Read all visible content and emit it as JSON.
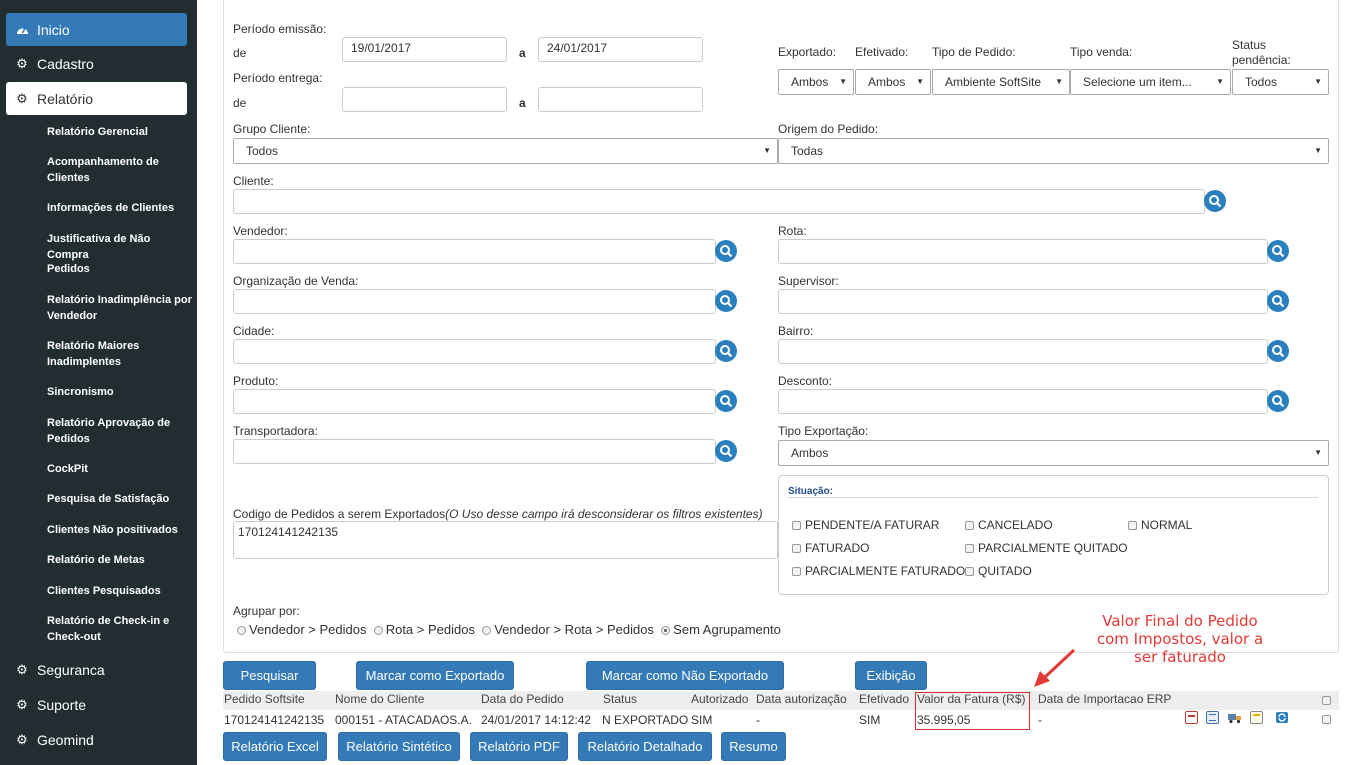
{
  "sidebar": {
    "top": [
      {
        "label": "Inicio",
        "icon": "dashboard-icon"
      },
      {
        "label": "Cadastro",
        "icon": "gears-icon"
      },
      {
        "label": "Relatório",
        "icon": "gears-icon"
      }
    ],
    "subitems": [
      "Relatório Gerencial",
      "Acompanhamento de Clientes",
      "Informações de Clientes",
      "Justificativa de Não Compra",
      "Pedidos",
      "Relatório Inadimplência por Vendedor",
      "Relatório Maiores Inadimplentes",
      "Sincronismo",
      "Relatório Aprovação de Pedidos",
      "CockPit",
      "Pesquisa de Satisfação",
      "Clientes Não positivados",
      "Relatório de Metas",
      "Clientes Pesquisados",
      "Relatório de Check-in e Check-out"
    ],
    "bottom": [
      {
        "label": "Seguranca",
        "icon": "gears-icon"
      },
      {
        "label": "Suporte",
        "icon": "gears-icon"
      },
      {
        "label": "Geomind",
        "icon": "gears-icon"
      }
    ]
  },
  "filters": {
    "periodo_emissao": "Período emissão:",
    "de": "de",
    "a": "a",
    "emissao_de": "19/01/2017",
    "emissao_ate": "24/01/2017",
    "periodo_entrega": "Período entrega:",
    "entrega_de": "",
    "entrega_ate": "",
    "exportado_label": "Exportado:",
    "exportado_value": "Ambos",
    "efetivado_label": "Efetivado:",
    "efetivado_value": "Ambos",
    "tipo_pedido_label": "Tipo de Pedido:",
    "tipo_pedido_value": "Ambiente SoftSite",
    "tipo_venda_label": "Tipo venda:",
    "tipo_venda_value": "Selecione um item...",
    "status_pendencia_label": "Status pendência:",
    "status_pendencia_value": "Todos",
    "grupo_cliente_label": "Grupo Cliente:",
    "grupo_cliente_value": "Todos",
    "origem_pedido_label": "Origem do Pedido:",
    "origem_pedido_value": "Todas",
    "cliente_label": "Cliente:",
    "vendedor_label": "Vendedor:",
    "rota_label": "Rota:",
    "org_venda_label": "Organização de Venda:",
    "supervisor_label": "Supervisor:",
    "cidade_label": "Cidade:",
    "bairro_label": "Bairro:",
    "produto_label": "Produto:",
    "desconto_label": "Desconto:",
    "transportadora_label": "Transportadora:",
    "tipo_exportacao_label": "Tipo Exportação:",
    "tipo_exportacao_value": "Ambos",
    "codigo_label": "Codigo de Pedidos a serem Exportados",
    "codigo_hint": "(O Uso desse campo irá desconsiderar os filtros existentes)",
    "codigo_value": "170124141242135",
    "situacao_title": "Situação:",
    "situacao": [
      "PENDENTE/A FATURAR",
      "CANCELADO",
      "NORMAL",
      "FATURADO",
      "PARCIALMENTE QUITADO",
      "PARCIALMENTE FATURADO",
      "QUITADO"
    ],
    "agrupar_label": "Agrupar por:",
    "agrupar": [
      "Vendedor > Pedidos",
      "Rota > Pedidos",
      "Vendedor > Rota > Pedidos",
      "Sem Agrupamento"
    ],
    "agrupar_selected": "Sem Agrupamento"
  },
  "actions": {
    "pesquisar": "Pesquisar",
    "marcar_exportado": "Marcar como Exportado",
    "marcar_nao_exportado": "Marcar como Não Exportado",
    "exibicao": "Exibição"
  },
  "table": {
    "headers": [
      "Pedido Softsite",
      "Nome do Cliente",
      "Data do Pedido",
      "Status",
      "Autorizado",
      "Data autorização",
      "Efetivado",
      "Valor da Fatura (R$)",
      "Data de Importacao ERP"
    ],
    "row": [
      "170124141242135",
      "000151 - ATACADAOS.A.",
      "24/01/2017 14:12:42",
      "N EXPORTADO",
      "SIM",
      "-",
      "SIM",
      "35.995,05",
      "-"
    ],
    "row_icons": [
      "pdf-icon",
      "document-icon",
      "truck-icon",
      "note-icon",
      "sync-icon"
    ]
  },
  "reports": {
    "excel": "Relatório Excel",
    "sintetico": "Relatório Sintético",
    "pdf": "Relatório PDF",
    "detalhado": "Relatório Detalhado",
    "resumo": "Resumo"
  },
  "annotation": {
    "lines": [
      "Valor Final do Pedido",
      "com Impostos, valor a",
      "ser faturado"
    ],
    "color": "#e53935"
  }
}
